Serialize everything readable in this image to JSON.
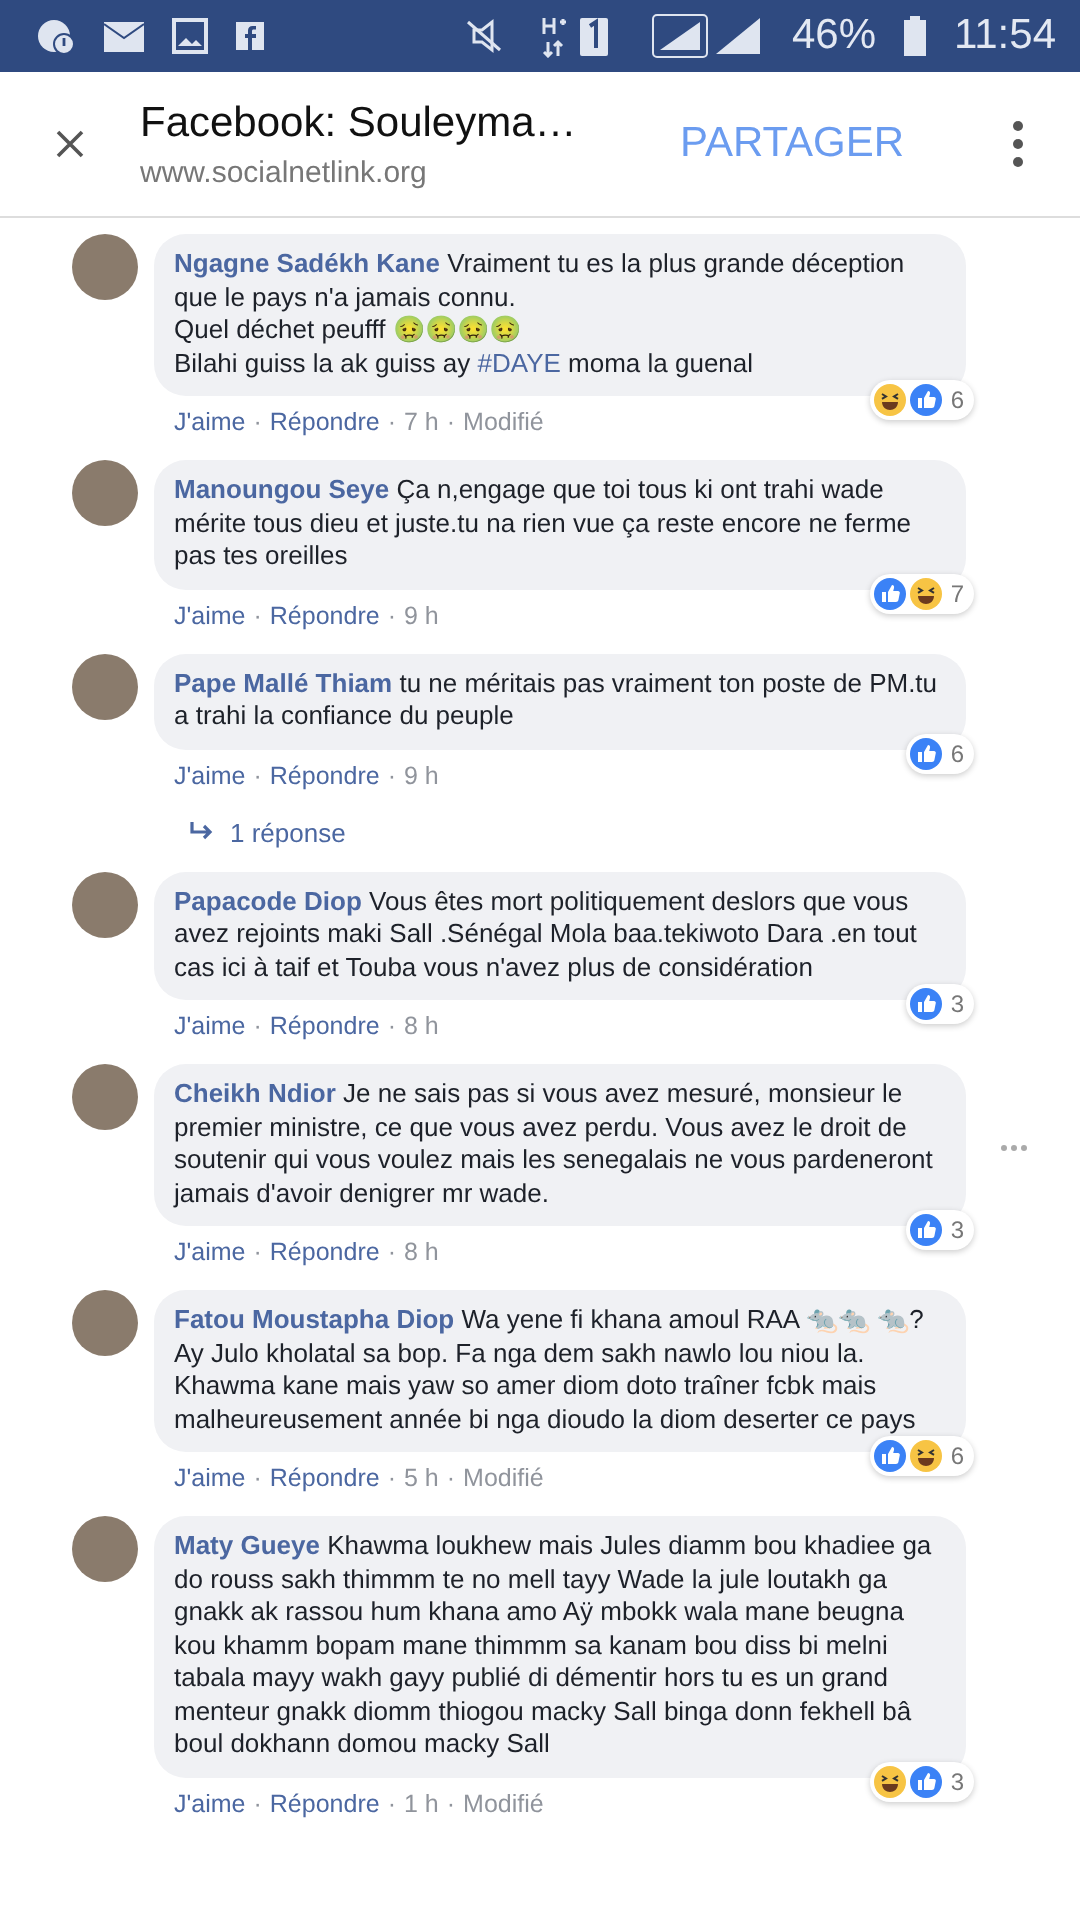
{
  "status_bar": {
    "battery": "46%",
    "time": "11:54"
  },
  "header": {
    "title": "Facebook: Souleyma…",
    "url": "www.socialnetlink.org",
    "share": "PARTAGER"
  },
  "comments": [
    {
      "author": "Ngagne Sadékh Kane",
      "body": [
        {
          "kind": "text",
          "text": "Vraiment tu es la plus grande déception que le pays n'a jamais connu.\nQuel déchet peufff 🤢🤢🤢🤢\nBilahi guiss la ak guiss ay "
        },
        {
          "kind": "hashtag",
          "text": "#DAYE"
        },
        {
          "kind": "text",
          "text": " moma la guenal"
        }
      ],
      "reactions": [
        {
          "kind": "haha"
        },
        {
          "kind": "like"
        }
      ],
      "count": "6",
      "footer": [
        {
          "kind": "like",
          "text": "J'aime"
        },
        {
          "kind": "dot",
          "text": "·"
        },
        {
          "kind": "reply",
          "text": "Répondre"
        },
        {
          "kind": "dot",
          "text": "·"
        },
        {
          "kind": "time",
          "text": "7 h"
        },
        {
          "kind": "dot",
          "text": "·"
        },
        {
          "kind": "edited",
          "text": "Modifié"
        }
      ],
      "more": false
    },
    {
      "author": "Manoungou Seye",
      "body": [
        {
          "kind": "text",
          "text": "Ça n,engage que toi tous ki ont trahi wade mérite tous dieu et juste.tu na rien vue ça reste encore ne ferme pas tes oreilles"
        }
      ],
      "reactions": [
        {
          "kind": "like"
        },
        {
          "kind": "haha"
        }
      ],
      "count": "7",
      "footer": [
        {
          "kind": "like",
          "text": "J'aime"
        },
        {
          "kind": "dot",
          "text": "·"
        },
        {
          "kind": "reply",
          "text": "Répondre"
        },
        {
          "kind": "dot",
          "text": "·"
        },
        {
          "kind": "time",
          "text": "9 h"
        }
      ],
      "more": false
    },
    {
      "author": "Pape Mallé Thiam",
      "body": [
        {
          "kind": "text",
          "text": "tu ne méritais pas vraiment ton poste de PM.tu a trahi la confiance du peuple"
        }
      ],
      "reactions": [
        {
          "kind": "like"
        }
      ],
      "count": "6",
      "footer": [
        {
          "kind": "like",
          "text": "J'aime"
        },
        {
          "kind": "dot",
          "text": "·"
        },
        {
          "kind": "reply",
          "text": "Répondre"
        },
        {
          "kind": "dot",
          "text": "·"
        },
        {
          "kind": "time",
          "text": "9 h"
        }
      ],
      "replies": "1 réponse",
      "more": false
    },
    {
      "author": "Papacode Diop",
      "body": [
        {
          "kind": "text",
          "text": "Vous êtes mort politiquement deslors que vous avez rejoints maki Sall .Sénégal Mola baa.tekiwoto Dara .en tout cas ici à taif et Touba vous n'avez plus de considération"
        }
      ],
      "reactions": [
        {
          "kind": "like"
        }
      ],
      "count": "3",
      "footer": [
        {
          "kind": "like",
          "text": "J'aime"
        },
        {
          "kind": "dot",
          "text": "·"
        },
        {
          "kind": "reply",
          "text": "Répondre"
        },
        {
          "kind": "dot",
          "text": "·"
        },
        {
          "kind": "time",
          "text": "8 h"
        }
      ],
      "more": false
    },
    {
      "author": "Cheikh Ndior",
      "body": [
        {
          "kind": "text",
          "text": "Je ne sais pas si vous avez mesuré, monsieur le premier ministre, ce que vous avez perdu. Vous avez le droit de soutenir qui vous voulez mais les senegalais ne vous pardeneront jamais d'avoir denigrer mr wade."
        }
      ],
      "reactions": [
        {
          "kind": "like"
        }
      ],
      "count": "3",
      "footer": [
        {
          "kind": "like",
          "text": "J'aime"
        },
        {
          "kind": "dot",
          "text": "·"
        },
        {
          "kind": "reply",
          "text": "Répondre"
        },
        {
          "kind": "dot",
          "text": "·"
        },
        {
          "kind": "time",
          "text": "8 h"
        }
      ],
      "more": true
    },
    {
      "author": "Fatou Moustapha Diop",
      "body": [
        {
          "kind": "text",
          "text": "Wa yene fi khana amoul RAA 🐀🐀 🐀?\nAy Julo kholatal sa bop. Fa nga dem sakh nawlo lou niou la. Khawma kane mais yaw so amer diom doto traîner fcbk mais malheureusement année bi nga dioudo la diom deserter ce pays"
        }
      ],
      "reactions": [
        {
          "kind": "like"
        },
        {
          "kind": "haha"
        }
      ],
      "count": "6",
      "footer": [
        {
          "kind": "like",
          "text": "J'aime"
        },
        {
          "kind": "dot",
          "text": "·"
        },
        {
          "kind": "reply",
          "text": "Répondre"
        },
        {
          "kind": "dot",
          "text": "·"
        },
        {
          "kind": "time",
          "text": "5 h"
        },
        {
          "kind": "dot",
          "text": "·"
        },
        {
          "kind": "edited",
          "text": "Modifié"
        }
      ],
      "more": false
    },
    {
      "author": "Maty Gueye",
      "body": [
        {
          "kind": "text",
          "text": "Khawma loukhew mais Jules diamm bou khadiee ga do rouss sakh thimmm te no mell tayy Wade la jule loutakh ga gnakk ak rassou hum khana amo Aÿ mbokk wala mane beugna kou khamm bopam mane thimmm sa kanam bou diss bi melni tabala mayy wakh gayy publié di démentir hors tu es un grand menteur gnakk diomm thiogou macky Sall binga donn fekhell bâ boul dokhann domou macky Sall"
        }
      ],
      "reactions": [
        {
          "kind": "haha"
        },
        {
          "kind": "like"
        }
      ],
      "count": "3",
      "footer": [
        {
          "kind": "like",
          "text": "J'aime"
        },
        {
          "kind": "dot",
          "text": "·"
        },
        {
          "kind": "reply",
          "text": "Répondre"
        },
        {
          "kind": "dot",
          "text": "·"
        },
        {
          "kind": "time",
          "text": "1 h"
        },
        {
          "kind": "dot",
          "text": "·"
        },
        {
          "kind": "edited",
          "text": "Modifié"
        }
      ],
      "more": false
    }
  ]
}
